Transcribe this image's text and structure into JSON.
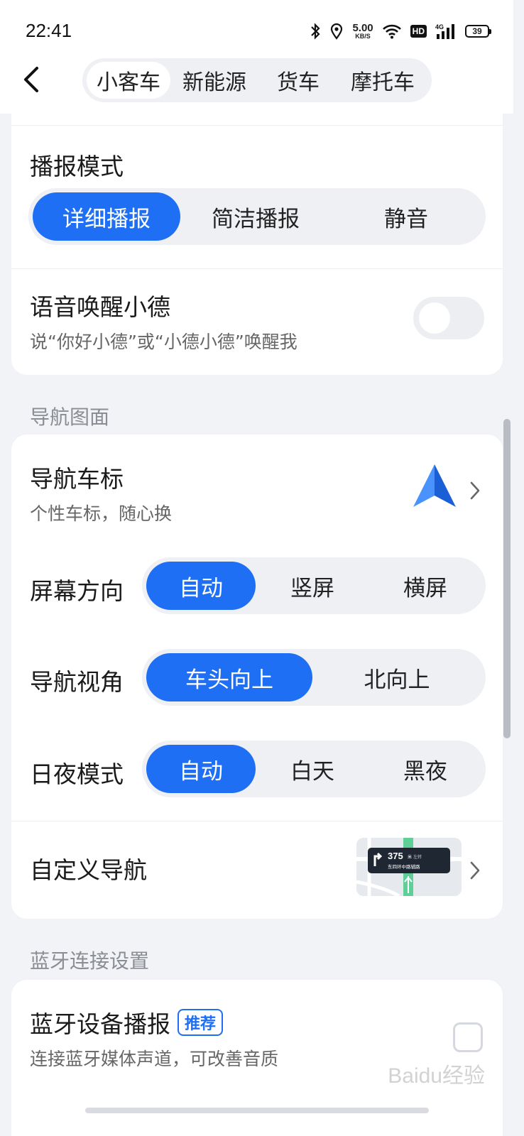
{
  "status_bar": {
    "time": "22:41",
    "speed_value": "5.00",
    "speed_unit": "KB/S",
    "hd_label": "HD",
    "network_label": "4G",
    "battery": "39"
  },
  "header": {
    "tabs": [
      {
        "label": "小客车",
        "active": true
      },
      {
        "label": "新能源",
        "active": false
      },
      {
        "label": "货车",
        "active": false
      },
      {
        "label": "摩托车",
        "active": false
      }
    ]
  },
  "voice_card": {
    "broadcast_title": "播报模式",
    "broadcast_options": [
      "详细播报",
      "简洁播报",
      "静音"
    ],
    "broadcast_selected": "详细播报",
    "wake_title": "语音唤醒小德",
    "wake_sub": "说“你好小德”或“小德小德”唤醒我",
    "wake_enabled": false
  },
  "nav_section": {
    "label": "导航图面",
    "car_icon_title": "导航车标",
    "car_icon_sub": "个性车标，随心换",
    "orientation_title": "屏幕方向",
    "orientation_options": [
      "自动",
      "竖屏",
      "横屏"
    ],
    "orientation_selected": "自动",
    "view_title": "导航视角",
    "view_options": [
      "车头向上",
      "北向上"
    ],
    "view_selected": "车头向上",
    "day_night_title": "日夜模式",
    "day_night_options": [
      "自动",
      "白天",
      "黑夜"
    ],
    "day_night_selected": "自动",
    "custom_title": "自定义导航",
    "preview_distance": "375",
    "preview_unit": "米",
    "preview_turn": "左转",
    "preview_road": "东四环中路辅路"
  },
  "bluetooth_section": {
    "label": "蓝牙连接设置",
    "device_title": "蓝牙设备播报",
    "device_tag": "推荐",
    "device_sub": "连接蓝牙媒体声道，可改善音质",
    "device_checked": false
  },
  "watermark": "Baidu经验",
  "colors": {
    "accent": "#1f6ff5",
    "background": "#f2f3f7",
    "card": "#ffffff"
  }
}
